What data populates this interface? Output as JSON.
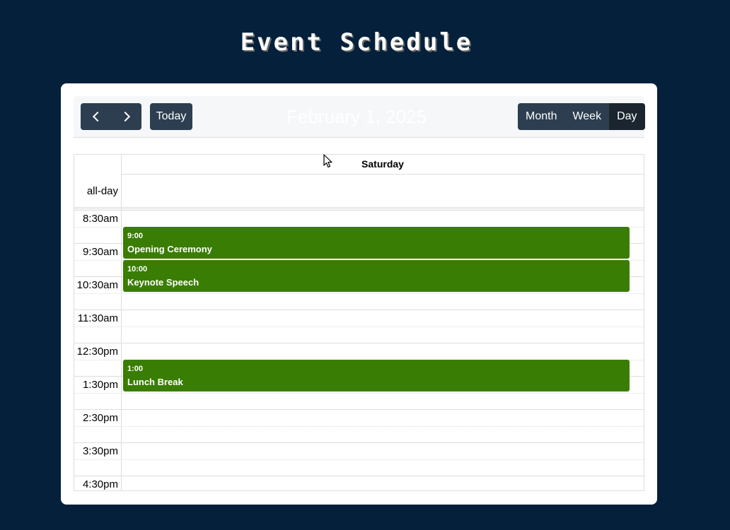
{
  "page": {
    "title": "Event Schedule"
  },
  "toolbar": {
    "title": "February 1, 2025",
    "today_label": "Today",
    "views": [
      "Month",
      "Week",
      "Day"
    ],
    "active_view": "Day"
  },
  "calendar": {
    "day_header": "Saturday",
    "allday_label": "all-day",
    "time_labels": [
      "8:30am",
      "9:30am",
      "10:30am",
      "11:30am",
      "12:30pm",
      "1:30pm",
      "2:30pm",
      "3:30pm",
      "4:30pm"
    ],
    "events": [
      {
        "time": "9:00",
        "title": "Opening Ceremony"
      },
      {
        "time": "10:00",
        "title": "Keynote Speech"
      },
      {
        "time": "1:00",
        "title": "Lunch Break"
      }
    ]
  },
  "colors": {
    "background": "#04203a",
    "event": "#3a7d04",
    "button": "#2c3e50",
    "button_active": "#1a252f"
  }
}
